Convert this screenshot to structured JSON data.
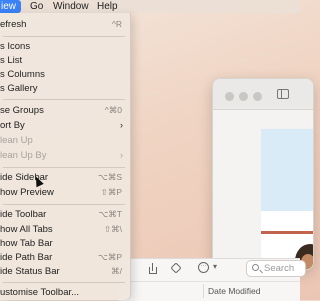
{
  "menubar": {
    "items": [
      {
        "label": "iew",
        "active": true
      },
      {
        "label": "Go"
      },
      {
        "label": "Window"
      },
      {
        "label": "Help"
      }
    ]
  },
  "view_menu": {
    "items": [
      {
        "label": "efresh",
        "shortcut": "^R"
      },
      {
        "label": "s Icons",
        "shortcut": ""
      },
      {
        "label": "s List",
        "shortcut": ""
      },
      {
        "label": "s Columns",
        "shortcut": ""
      },
      {
        "label": "s Gallery",
        "shortcut": ""
      },
      {
        "label": "se Groups",
        "shortcut": "^⌘0"
      },
      {
        "label": "ort By",
        "submenu": true
      },
      {
        "label": "lean Up",
        "disabled": true
      },
      {
        "label": "lean Up By",
        "disabled": true,
        "submenu": true
      },
      {
        "label": "ide Sidebar",
        "shortcut": "⌥⌘S"
      },
      {
        "label": "how Preview",
        "shortcut": "⇧⌘P"
      },
      {
        "label": "ide Toolbar",
        "shortcut": "⌥⌘T"
      },
      {
        "label": "how All Tabs",
        "shortcut": "⇧⌘\\"
      },
      {
        "label": "how Tab Bar",
        "shortcut": ""
      },
      {
        "label": "ide Path Bar",
        "shortcut": "⌥⌘P"
      },
      {
        "label": "ide Status Bar",
        "shortcut": "⌘/"
      },
      {
        "label": "ustomise Toolbar...",
        "shortcut": ""
      }
    ]
  },
  "finder_toolbar": {
    "search_placeholder": "Search",
    "more_glyph": "···",
    "column_date_modified": "Date Modified"
  },
  "icons": [
    "share-icon",
    "tag-icon",
    "more-options-icon",
    "chevron-down-icon",
    "search-icon",
    "sidebar-toggle-icon",
    "mouse-pointer-icon"
  ]
}
